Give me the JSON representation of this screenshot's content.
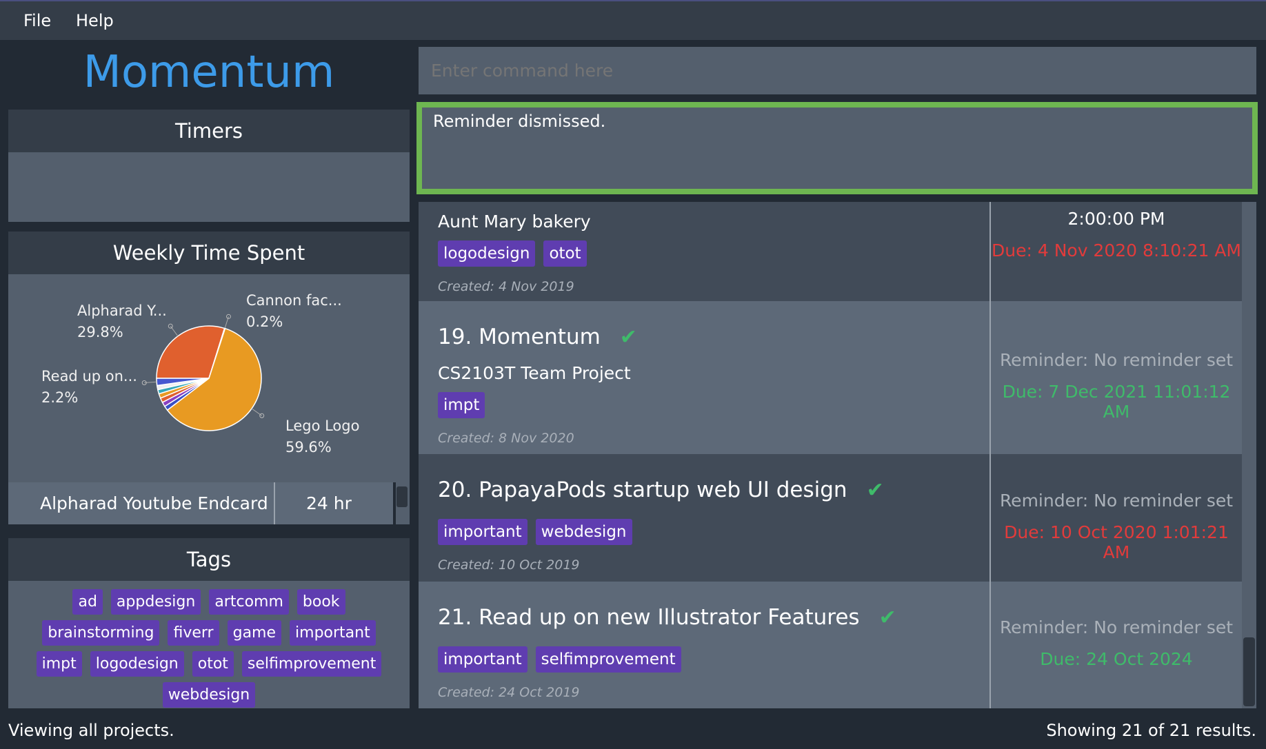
{
  "menu": {
    "file": "File",
    "help": "Help"
  },
  "app_title": "Momentum",
  "command": {
    "placeholder": "Enter command here",
    "value": ""
  },
  "result_message": "Reminder dismissed.",
  "timers": {
    "title": "Timers"
  },
  "weekly": {
    "title": "Weekly Time Spent",
    "table": {
      "project": "Alpharad Youtube Endcard",
      "time": "24 hr"
    }
  },
  "chart_data": {
    "type": "pie",
    "slices": [
      {
        "label": "Alpharad Y...",
        "pct_label": "29.8%",
        "value": 29.8,
        "color": "#e0602e"
      },
      {
        "label": "Cannon fac...",
        "pct_label": "0.2%",
        "value": 0.2,
        "color": "#7fc79a"
      },
      {
        "label": "Lego Logo",
        "pct_label": "59.6%",
        "value": 59.6,
        "color": "#e89a22"
      },
      {
        "value": 1.4,
        "color": "#3a4fc4"
      },
      {
        "value": 1.4,
        "color": "#8a3fc0"
      },
      {
        "value": 1.4,
        "color": "#e0602e"
      },
      {
        "value": 1.4,
        "color": "#e89a22"
      },
      {
        "value": 1.3,
        "color": "#35a8b8"
      },
      {
        "value": 1.3,
        "color": "#f0f0f0"
      },
      {
        "label": "Read up on...",
        "pct_label": "2.2%",
        "value": 2.2,
        "color": "#4658d0"
      }
    ]
  },
  "tags": {
    "title": "Tags",
    "items": [
      "ad",
      "appdesign",
      "artcomm",
      "book",
      "brainstorming",
      "fiverr",
      "game",
      "important",
      "impt",
      "logodesign",
      "otot",
      "selfimprovement",
      "webdesign"
    ]
  },
  "projects": [
    {
      "name": "",
      "description": "Aunt Mary bakery",
      "tags": [
        "logodesign",
        "otot"
      ],
      "created": "Created: 4 Nov 2019",
      "reminder": "2:00:00 PM",
      "due": "Due: 4 Nov 2020 8:10:21 AM",
      "due_color": "#e23b3b"
    },
    {
      "name": "19. Momentum",
      "done": true,
      "description": "CS2103T Team Project",
      "tags": [
        "impt"
      ],
      "created": "Created: 8 Nov 2020",
      "reminder": "Reminder: No reminder set",
      "due": "Due: 7 Dec 2021 11:01:12 AM",
      "due_color": "#3fbb6a"
    },
    {
      "name": "20. PapayaPods startup web UI design",
      "done": true,
      "tags": [
        "important",
        "webdesign"
      ],
      "created": "Created: 10 Oct 2019",
      "reminder": "Reminder: No reminder set",
      "due": "Due: 10 Oct 2020 1:01:21 AM",
      "due_color": "#e23b3b"
    },
    {
      "name": "21. Read up on new Illustrator Features",
      "done": true,
      "tags": [
        "important",
        "selfimprovement"
      ],
      "created": "Created: 24 Oct 2019",
      "reminder": "Reminder: No reminder set",
      "due": "Due: 24 Oct 2024",
      "due_color": "#3fbb6a"
    }
  ],
  "check_glyph": "✔",
  "status": {
    "left": "Viewing all projects.",
    "right": "Showing 21 of 21 results."
  }
}
